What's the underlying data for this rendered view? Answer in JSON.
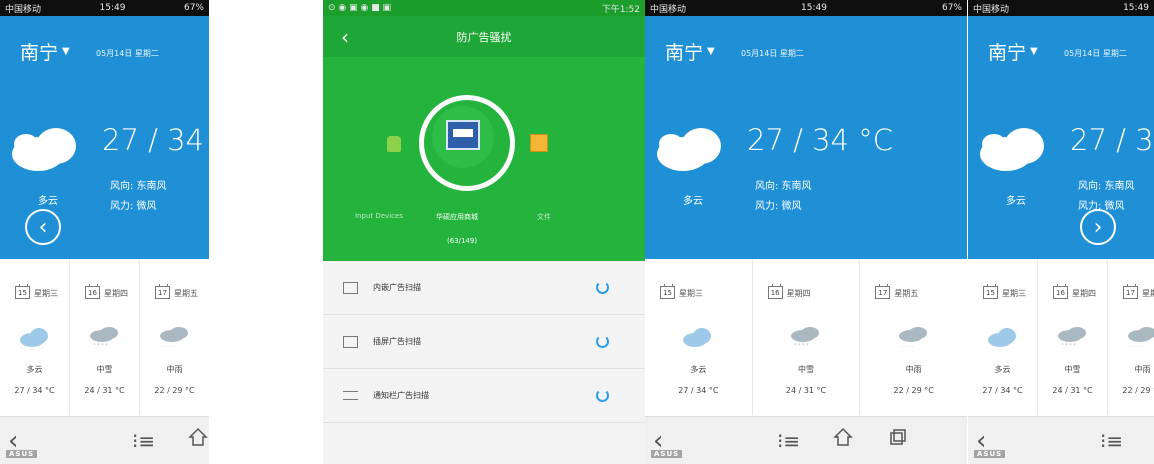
{
  "weather": {
    "status_left": "中国移动",
    "status_time": "15:49",
    "status_battery": "67%",
    "city": "南宁",
    "date": "05月14日  星期二",
    "temp": "27 / 34 °C",
    "wind_dir": "风向: 东南风",
    "wind_force": "风力: 微风",
    "today_condition": "多云",
    "forecast": [
      {
        "day": "15",
        "weekday": "星期三",
        "condition": "多云",
        "temp": "27 / 34 °C"
      },
      {
        "day": "16",
        "weekday": "星期四",
        "condition": "中雪",
        "temp": "24 / 31 °C"
      },
      {
        "day": "17",
        "weekday": "星期五",
        "condition": "中雨",
        "temp": "22 / 29 °C"
      }
    ],
    "watermark": "ASUS"
  },
  "scanner": {
    "status_time": "下午1:52",
    "title": "防广告骚扰",
    "label_left": "Input Devices",
    "label_center": "华硕应用商城",
    "label_right": "文件",
    "count": "(63/149)",
    "rows": [
      {
        "label": "内嵌广告扫描"
      },
      {
        "label": "插屏广告扫描"
      },
      {
        "label": "通知栏广告扫描"
      }
    ]
  }
}
